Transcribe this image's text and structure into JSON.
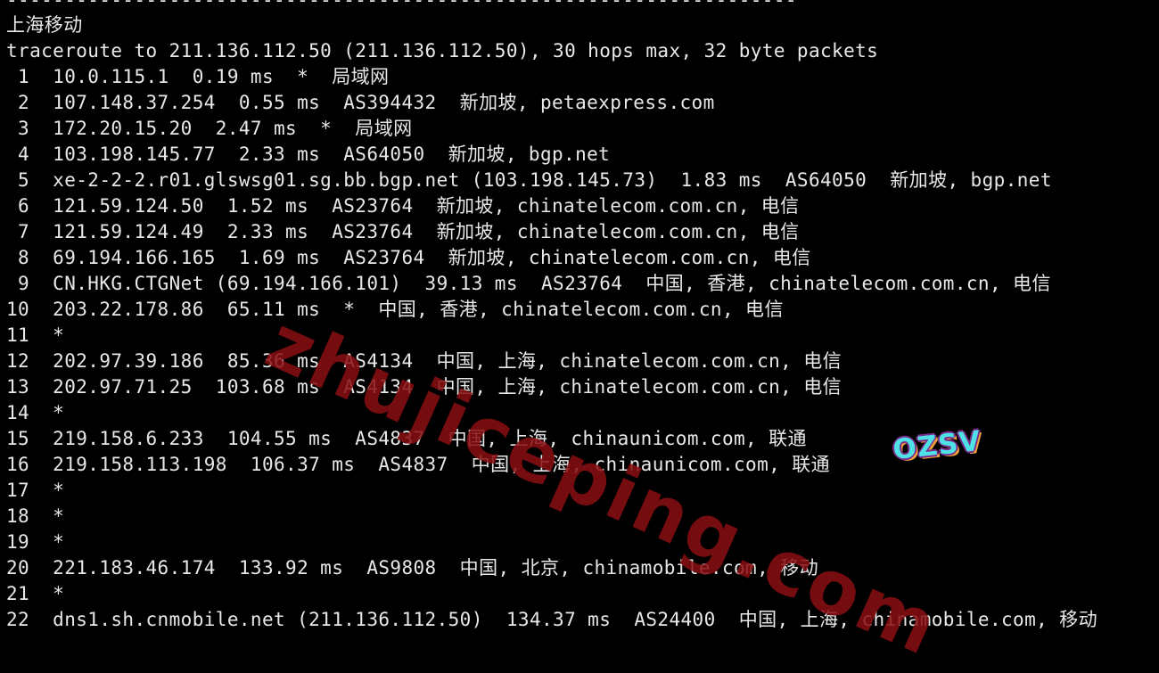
{
  "terminal": {
    "rule": "--------------------------------------------------------------------",
    "isp_label": "上海移动",
    "header": "traceroute to 211.136.112.50 (211.136.112.50), 30 hops max, 32 byte packets",
    "hops": [
      " 1  10.0.115.1  0.19 ms  *  局域网",
      " 2  107.148.37.254  0.55 ms  AS394432  新加坡, petaexpress.com",
      " 3  172.20.15.20  2.47 ms  *  局域网",
      " 4  103.198.145.77  2.33 ms  AS64050  新加坡, bgp.net",
      " 5  xe-2-2-2.r01.glswsg01.sg.bb.bgp.net (103.198.145.73)  1.83 ms  AS64050  新加坡, bgp.net",
      " 6  121.59.124.50  1.52 ms  AS23764  新加坡, chinatelecom.com.cn, 电信",
      " 7  121.59.124.49  2.33 ms  AS23764  新加坡, chinatelecom.com.cn, 电信",
      " 8  69.194.166.165  1.69 ms  AS23764  新加坡, chinatelecom.com.cn, 电信",
      " 9  CN.HKG.CTGNet (69.194.166.101)  39.13 ms  AS23764  中国, 香港, chinatelecom.com.cn, 电信",
      "10  203.22.178.86  65.11 ms  *  中国, 香港, chinatelecom.com.cn, 电信",
      "11  *",
      "12  202.97.39.186  85.36 ms  AS4134  中国, 上海, chinatelecom.com.cn, 电信",
      "13  202.97.71.25  103.68 ms  AS4134  中国, 上海, chinatelecom.com.cn, 电信",
      "14  *",
      "15  219.158.6.233  104.55 ms  AS4837  中国, 上海, chinaunicom.com, 联通",
      "16  219.158.113.198  106.37 ms  AS4837  中国, 上海, chinaunicom.com, 联通",
      "17  *",
      "18  *",
      "19  *",
      "20  221.183.46.174  133.92 ms  AS9808  中国, 北京, chinamobile.com, 移动",
      "21  *",
      "22  dns1.sh.cnmobile.net (211.136.112.50)  134.37 ms  AS24400  中国, 上海, chinamobile.com, 移动"
    ]
  },
  "overlay": {
    "watermark": "zhujiceping.com",
    "badge": "OZSV"
  },
  "colors": {
    "background": "#000000",
    "text": "#e8e8e8",
    "watermark": "#8a0f12"
  }
}
